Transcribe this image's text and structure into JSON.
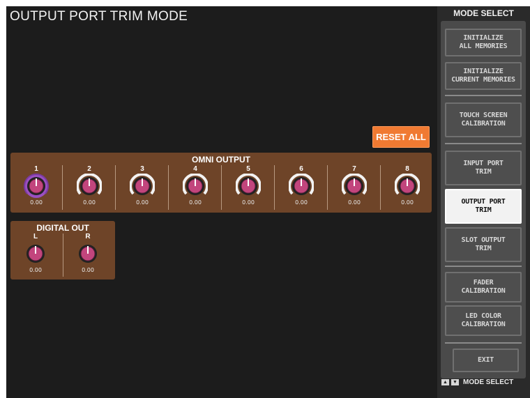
{
  "title": "OUTPUT PORT TRIM MODE",
  "reset_all": "RESET ALL",
  "omni": {
    "title": "OMNI OUTPUT",
    "channels": [
      {
        "label": "1",
        "value": "0.00"
      },
      {
        "label": "2",
        "value": "0.00"
      },
      {
        "label": "3",
        "value": "0.00"
      },
      {
        "label": "4",
        "value": "0.00"
      },
      {
        "label": "5",
        "value": "0.00"
      },
      {
        "label": "6",
        "value": "0.00"
      },
      {
        "label": "7",
        "value": "0.00"
      },
      {
        "label": "8",
        "value": "0.00"
      }
    ]
  },
  "digital": {
    "title": "DIGITAL OUT",
    "channels": [
      {
        "label": "L",
        "value": "0.00"
      },
      {
        "label": "R",
        "value": "0.00"
      }
    ]
  },
  "sidebar": {
    "title": "MODE SELECT",
    "buttons": [
      {
        "label": "INITIALIZE\nALL MEMORIES"
      },
      {
        "label": "INITIALIZE\nCURRENT MEMORIES"
      },
      {
        "label": "TOUCH SCREEN\nCALIBRATION"
      },
      {
        "label": "INPUT PORT\nTRIM"
      },
      {
        "label": "OUTPUT PORT\nTRIM"
      },
      {
        "label": "SLOT OUTPUT\nTRIM"
      },
      {
        "label": "FADER\nCALIBRATION"
      },
      {
        "label": "LED COLOR\nCALIBRATION"
      },
      {
        "label": "EXIT"
      }
    ],
    "footer": "MODE SELECT"
  },
  "colors": {
    "accent_orange": "#f07a32",
    "panel_brown": "#6e4428",
    "knob_magenta": "#c2457d",
    "selected_ring": "#9a4fc0"
  },
  "icons": [
    "up-arrow-icon",
    "down-arrow-icon"
  ]
}
